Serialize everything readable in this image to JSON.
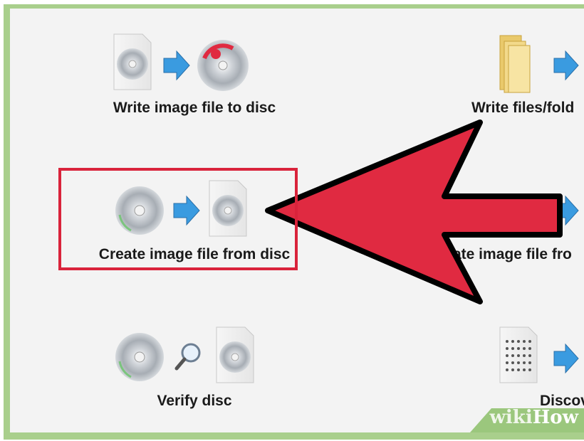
{
  "modes": {
    "write_image": {
      "label": "Write image file to disc"
    },
    "write_files": {
      "label": "Write files/fold"
    },
    "create_image": {
      "label": "Create image file from disc"
    },
    "create_image_files": {
      "label": "ate image file fro"
    },
    "verify": {
      "label": "Verify disc"
    },
    "discovery": {
      "label": "Discove"
    }
  },
  "watermark": {
    "wiki": "wiki",
    "how": "How"
  },
  "colors": {
    "frame": "#a9cf8c",
    "panel": "#f3f3f3",
    "highlight": "#d9233b",
    "arrow_fill": "#e02a41",
    "blue_arrow": "#3a9be0"
  },
  "icons": {
    "disc": "disc-icon",
    "image_file": "image-file-icon",
    "burn_disc": "burning-disc-icon",
    "folder": "folder-icon",
    "magnifier": "magnifier-icon",
    "arrow": "blue-arrow-icon",
    "test_pattern": "discovery-file-icon"
  }
}
